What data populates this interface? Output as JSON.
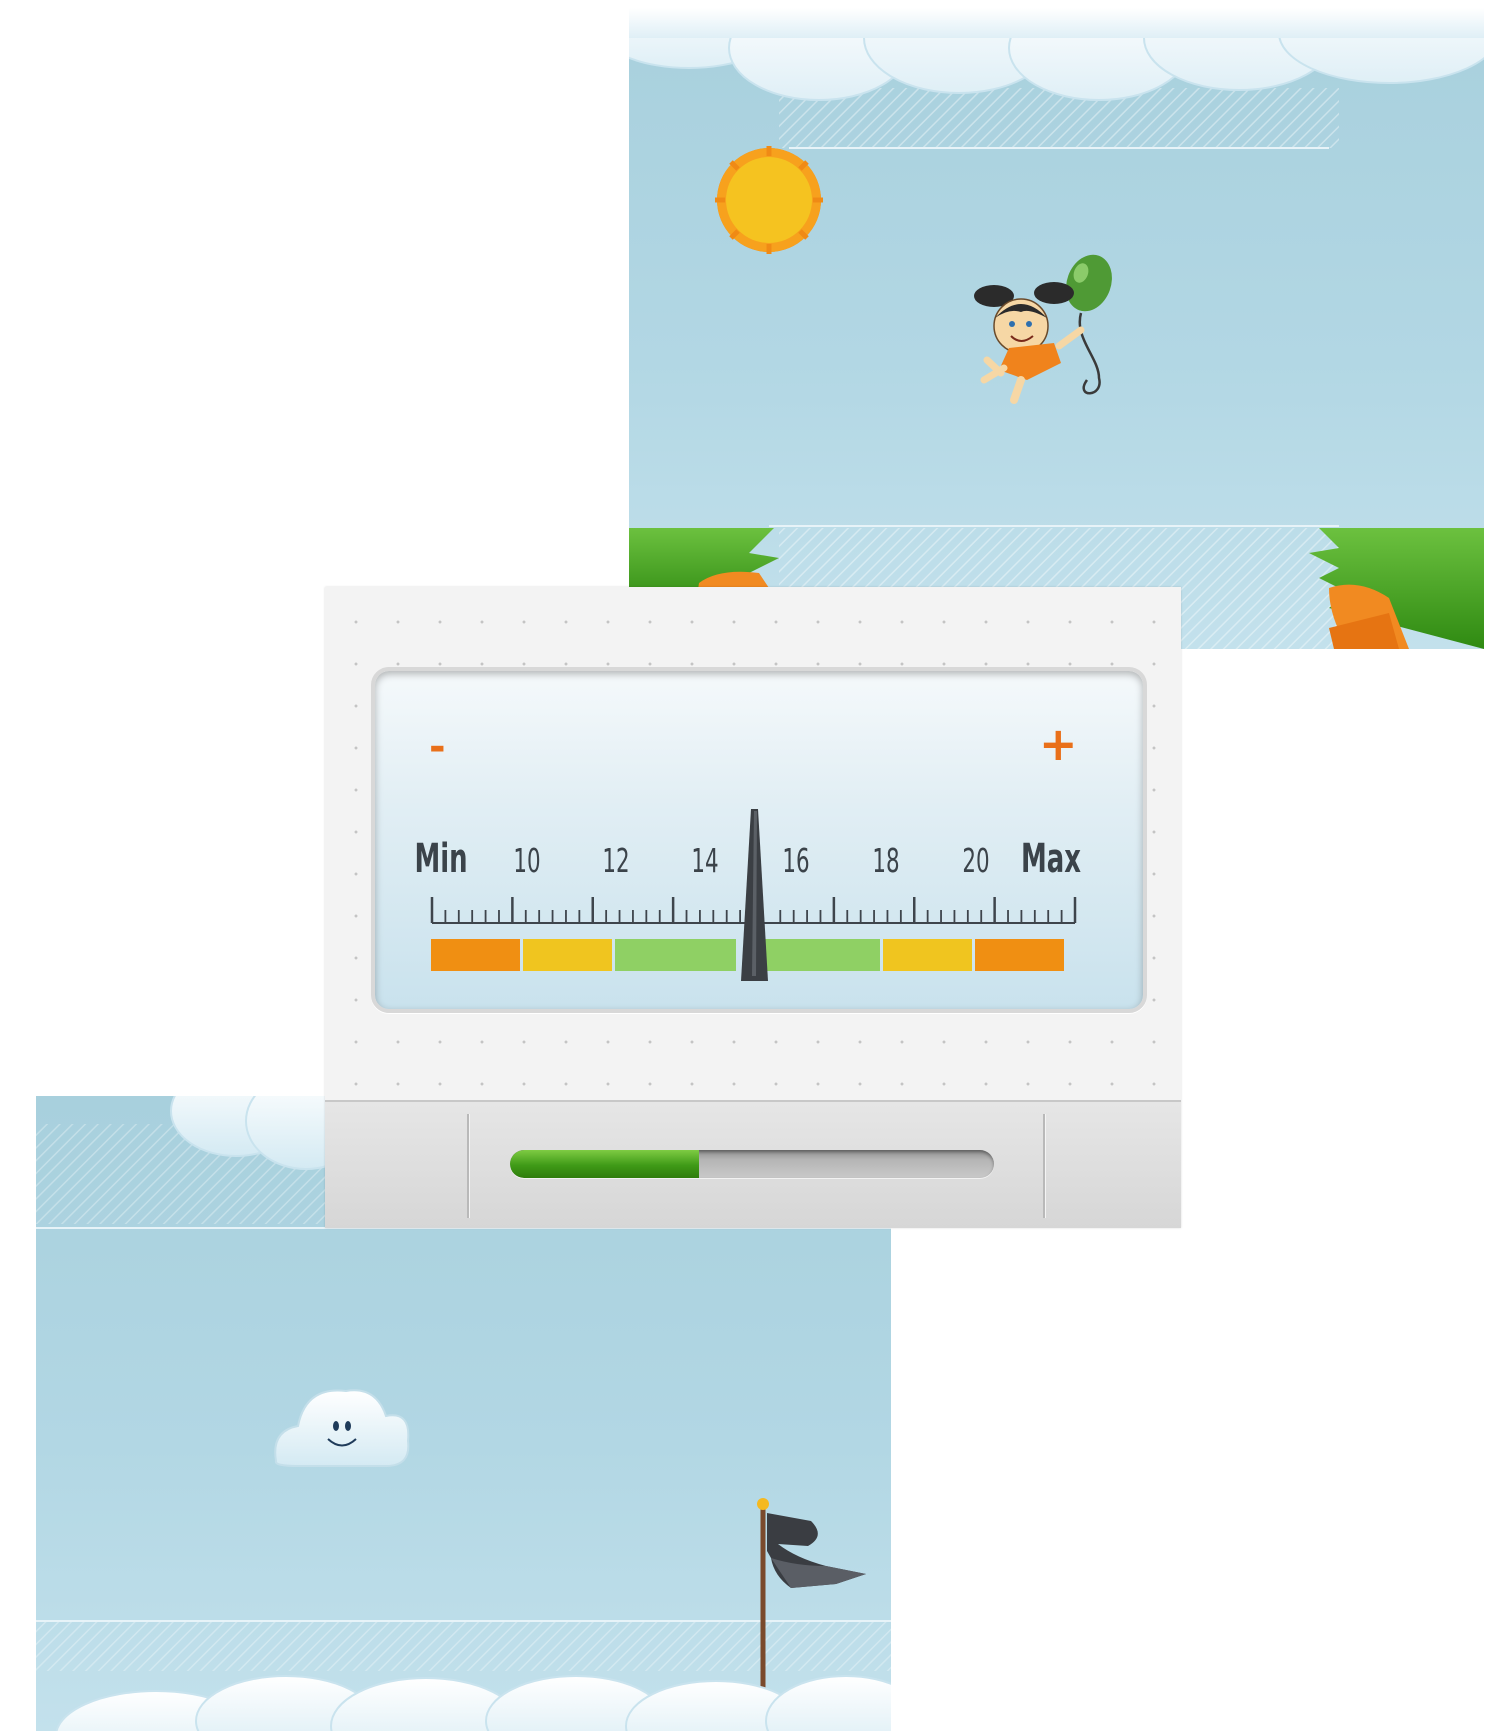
{
  "game": {
    "top_scene": {
      "characters": [
        "sun-icon",
        "girl-with-balloon-icon"
      ],
      "balloon_color": "#4f9a35"
    },
    "bottom_scene": {
      "characters": [
        "smiling-cloud-icon",
        "goal-flag-icon"
      ],
      "flag_color": "#3a3d42"
    }
  },
  "gauge": {
    "minus_label": "-",
    "plus_label": "+",
    "min_label": "Min",
    "max_label": "Max",
    "scale_labels": [
      "10",
      "12",
      "14",
      "16",
      "18",
      "20"
    ],
    "needle_position": "between 14 and 16",
    "zones": [
      {
        "name": "low-danger",
        "color": "#f08f12"
      },
      {
        "name": "low-warning",
        "color": "#f0c51f"
      },
      {
        "name": "ok",
        "color": "#8fd064"
      },
      {
        "name": "high-ok",
        "color": "#8fd064"
      },
      {
        "name": "high-warning",
        "color": "#f0c51f"
      },
      {
        "name": "high-danger",
        "color": "#f08f12"
      }
    ]
  },
  "progress": {
    "fraction": 0.39,
    "fill_color": "#3f9a17",
    "track_color": "#b5b5b5"
  }
}
